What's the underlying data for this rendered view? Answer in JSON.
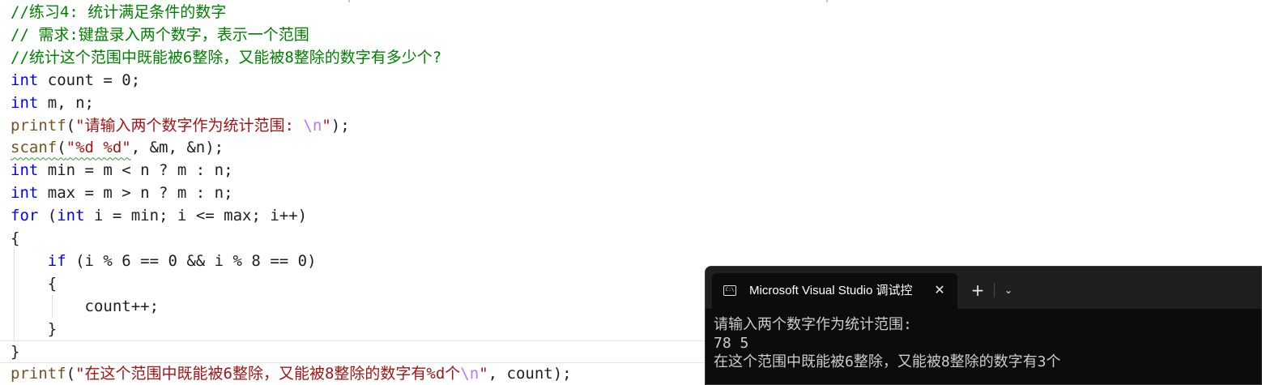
{
  "editor": {
    "lines": [
      {
        "parts": [
          {
            "t": "//练习4: 统计满足条件的数字",
            "c": "cm"
          }
        ]
      },
      {
        "parts": [
          {
            "t": "// 需求:键盘录入两个数字，表示一个范围",
            "c": "cm"
          }
        ]
      },
      {
        "parts": [
          {
            "t": "//统计这个范围中既能被6整除，又能被8整除的数字有多少个?",
            "c": "cm"
          }
        ]
      },
      {
        "parts": [
          {
            "t": "int",
            "c": "kw"
          },
          {
            "t": " count = 0;",
            "c": ""
          }
        ]
      },
      {
        "parts": [
          {
            "t": "int",
            "c": "kw"
          },
          {
            "t": " m, n;",
            "c": ""
          }
        ]
      },
      {
        "parts": [
          {
            "t": "printf",
            "c": "fn"
          },
          {
            "t": "(",
            "c": ""
          },
          {
            "t": "\"请输入两个数字作为统计范围: ",
            "c": "str"
          },
          {
            "t": "\\n",
            "c": "esc"
          },
          {
            "t": "\"",
            "c": "str"
          },
          {
            "t": ");",
            "c": ""
          }
        ]
      },
      {
        "parts": [
          {
            "t": "scanf",
            "c": "fn squig"
          },
          {
            "t": "(",
            "c": "squig"
          },
          {
            "t": "\"%d %d\"",
            "c": "str squig"
          },
          {
            "t": ", &m, &n);",
            "c": ""
          }
        ]
      },
      {
        "parts": [
          {
            "t": "int",
            "c": "kw"
          },
          {
            "t": " min = m < n ? m : n;",
            "c": ""
          }
        ]
      },
      {
        "parts": [
          {
            "t": "int",
            "c": "kw"
          },
          {
            "t": " max = m > n ? m : n;",
            "c": ""
          }
        ]
      },
      {
        "parts": [
          {
            "t": "for",
            "c": "kw"
          },
          {
            "t": " (",
            "c": ""
          },
          {
            "t": "int",
            "c": "kw"
          },
          {
            "t": " i = min; i <= max; i++)",
            "c": ""
          }
        ]
      },
      {
        "parts": [
          {
            "t": "{",
            "c": ""
          }
        ]
      },
      {
        "parts": [
          {
            "t": "    ",
            "c": ""
          },
          {
            "t": "if",
            "c": "kw"
          },
          {
            "t": " (i % 6 == 0 && i % 8 == 0)",
            "c": ""
          }
        ]
      },
      {
        "parts": [
          {
            "t": "    {",
            "c": ""
          }
        ]
      },
      {
        "parts": [
          {
            "t": "        count++;",
            "c": ""
          }
        ]
      },
      {
        "parts": [
          {
            "t": "    }",
            "c": ""
          }
        ]
      },
      {
        "parts": [
          {
            "t": "}",
            "c": ""
          }
        ]
      },
      {
        "parts": [
          {
            "t": "printf",
            "c": "fn"
          },
          {
            "t": "(",
            "c": ""
          },
          {
            "t": "\"在这个范围中既能被6整除，又能被8整除的数字有%d个",
            "c": "str"
          },
          {
            "t": "\\n",
            "c": "esc"
          },
          {
            "t": "\"",
            "c": "str"
          },
          {
            "t": ", count);",
            "c": ""
          }
        ]
      }
    ]
  },
  "terminal": {
    "tab_title": "Microsoft Visual Studio 调试控",
    "tab_icon": "console-app-icon",
    "close_glyph": "✕",
    "new_tab_glyph": "+",
    "dropdown_glyph": "⌄",
    "output": [
      "请输入两个数字作为统计范围:",
      "78 5",
      "在这个范围中既能被6整除，又能被8整除的数字有3个"
    ]
  },
  "colors": {
    "keyword": "#0000ff",
    "function": "#74531f",
    "string": "#a31515",
    "escape": "#b776fb",
    "comment": "#008000",
    "terminal_bg": "#0c0c0c"
  }
}
